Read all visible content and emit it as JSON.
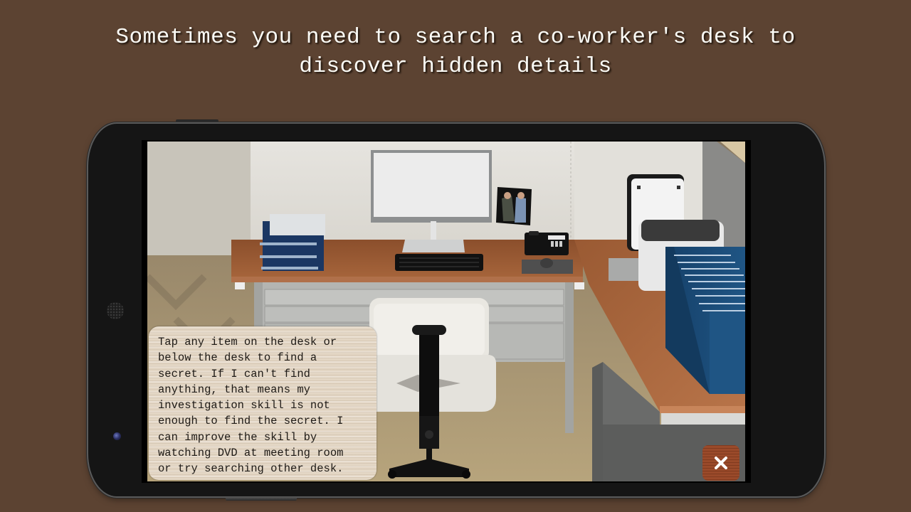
{
  "headline": {
    "line1": "Sometimes you need to search a co-worker's desk to",
    "line2": "discover hidden details"
  },
  "game": {
    "scene": "co-worker desk search",
    "scene_items": [
      "document-tray",
      "computer-monitor",
      "photo",
      "desk-phone",
      "keyboard",
      "mouse",
      "printer",
      "binders",
      "office-chair",
      "filing-cabinet",
      "paper-holder"
    ],
    "hint": "Tap any item on the desk or\nbelow the desk to find a\nsecret. If I can't find\nanything, that means my\ninvestigation skill is not\nenough to find the secret. I\ncan improve the skill by\nwatching DVD at meeting room\nor try searching other desk.",
    "close_icon": "close-icon"
  },
  "colors": {
    "background": "#5c4332",
    "phone_body": "#151515",
    "hint_panel": "#e3d6c4",
    "close_button": "#9a4a2a",
    "desk_wood": "#9a5a33",
    "binder_blue": "#1d4f7c"
  }
}
